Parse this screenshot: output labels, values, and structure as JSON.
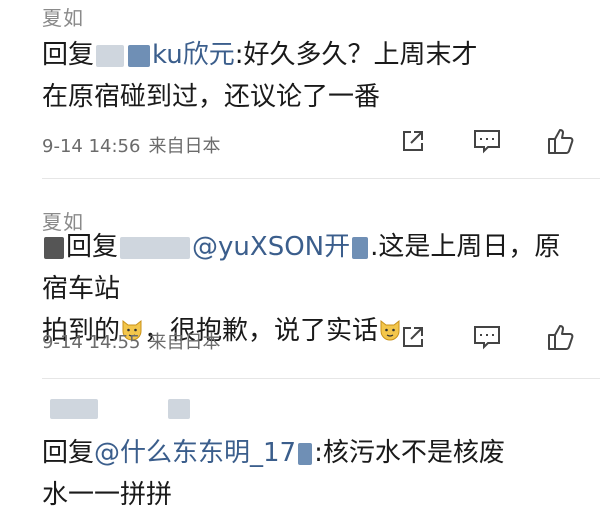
{
  "comments": [
    {
      "username": "夏如",
      "reply_prefix": "回复",
      "mention_tail": "ku欣元",
      "text_line1": ":好久多久？上周末才",
      "text_line2": "在原宿碰到过，还议论了一番",
      "date": "9-14 14:56",
      "source": "来自日本"
    },
    {
      "username": "夏如",
      "reply_prefix": "回复",
      "mention_tail": "@yuXSON开",
      "text_line1": ".这是上周日，原宿车站",
      "text_line2": "拍到的",
      "text_line2b": "，很抱歉，说了实话",
      "date": "9-14 14:55",
      "source": "来自日本"
    },
    {
      "username": "",
      "reply_prefix": "回复",
      "mention_tail": "@什么东东明_17",
      "text_line1": ":核污水不是核废",
      "text_line2": "水一一拼拼"
    }
  ],
  "icons": {
    "share": "share-icon",
    "comment": "comment-icon",
    "like": "thumbs-up-icon",
    "emoji": "cat-face-emoji"
  }
}
